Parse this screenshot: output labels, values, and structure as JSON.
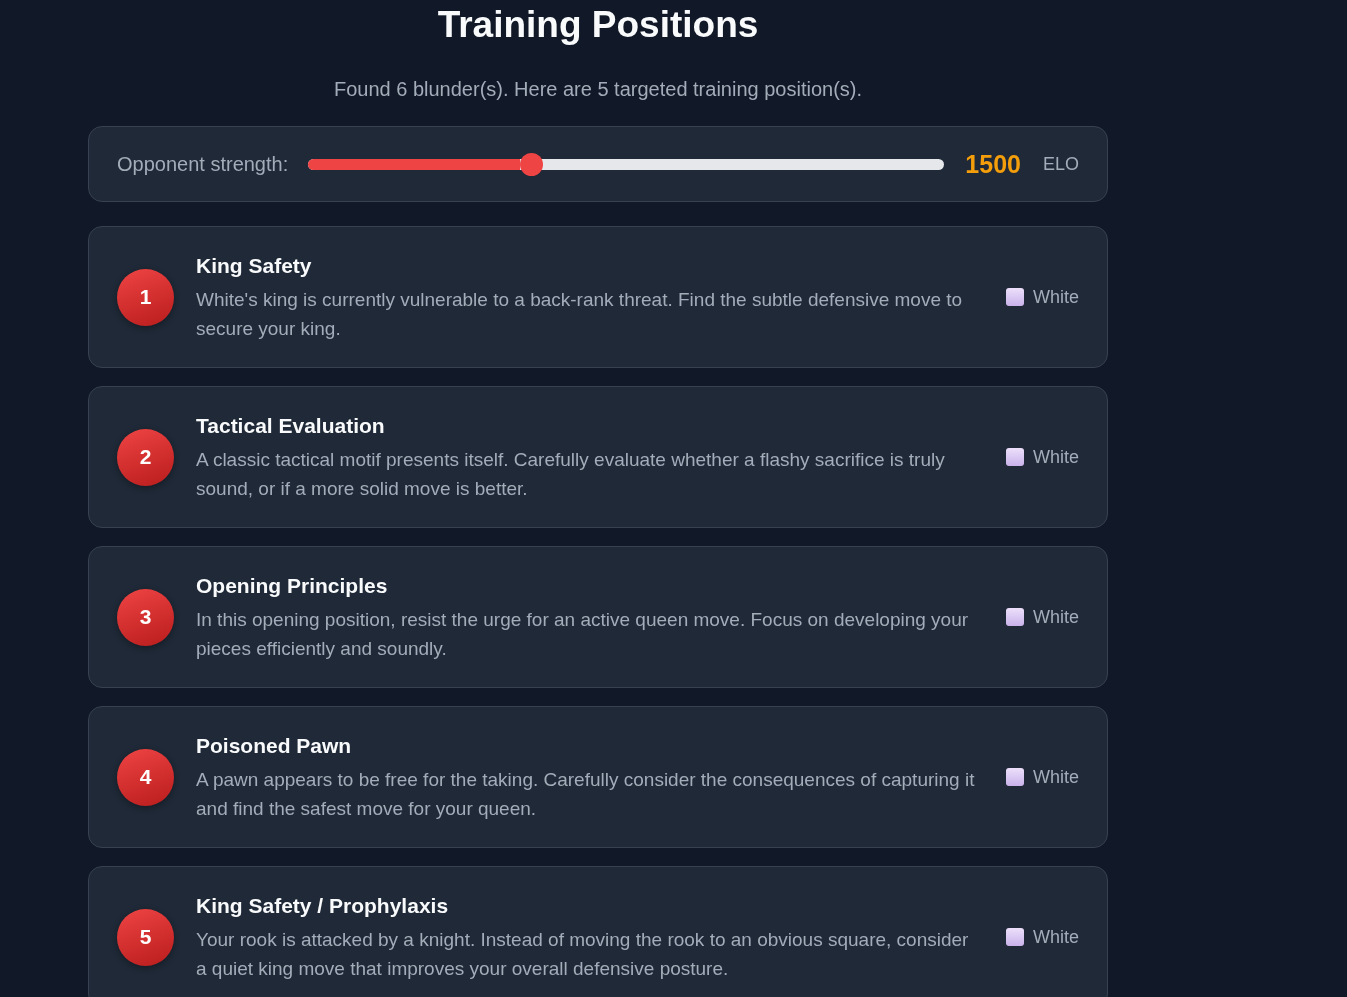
{
  "title": "Training Positions",
  "summary": "Found 6 blunder(s). Here are 5 targeted training position(s).",
  "strength": {
    "label": "Opponent strength:",
    "level": 0.35,
    "value": "1500",
    "unit": "ELO"
  },
  "positions": [
    {
      "number": "1",
      "title": "King Safety",
      "description": "White's king is currently vulnerable to a back-rank threat. Find the subtle defensive move to secure your king.",
      "side": "White"
    },
    {
      "number": "2",
      "title": "Tactical Evaluation",
      "description": "A classic tactical motif presents itself. Carefully evaluate whether a flashy sacrifice is truly sound, or if a more solid move is better.",
      "side": "White"
    },
    {
      "number": "3",
      "title": "Opening Principles",
      "description": "In this opening position, resist the urge for an active queen move. Focus on developing your pieces efficiently and soundly.",
      "side": "White"
    },
    {
      "number": "4",
      "title": "Poisoned Pawn",
      "description": "A pawn appears to be free for the taking. Carefully consider the consequences of capturing it and find the safest move for your queen.",
      "side": "White"
    },
    {
      "number": "5",
      "title": "King Safety / Prophylaxis",
      "description": "Your rook is attacked by a knight. Instead of moving the rook to an obvious square, consider a quiet king move that improves your overall defensive posture.",
      "side": "White"
    }
  ]
}
